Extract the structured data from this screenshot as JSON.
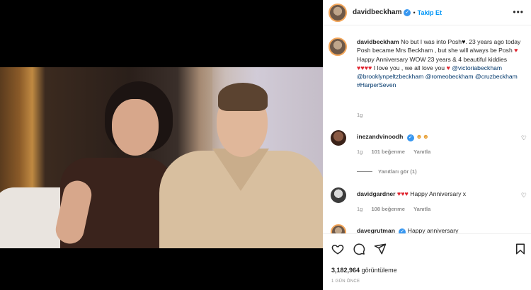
{
  "header": {
    "username": "davidbeckham",
    "separator": "•",
    "follow_label": "Takip Et",
    "more_icon": "more-icon"
  },
  "caption": {
    "username": "davidbeckham",
    "line1": "No but I was into Posh",
    "line1b": ". 23",
    "line2": "years ago today Posh became Mrs Beckham , but",
    "line3a": "she will always be Posh",
    "line3b": "Happy Anniversary",
    "line4": "WOW 23 years & 4 beautiful kiddies",
    "line5a": "I love you , we all love you",
    "mention1": "@victoriabeckham",
    "mention2": "@brooklynpeltzbeckham",
    "mention3": "@romeobeckham",
    "mention4": "@cruzbeckham",
    "tag1": "#HarperSeven",
    "time": "1g"
  },
  "comments": [
    {
      "username": "inezandvinoodh",
      "text": "",
      "time": "1g",
      "likes": "101 beğenme",
      "reply": "Yanıtla"
    },
    {
      "username": "davidgardner",
      "text": "Happy Anniversary x",
      "time": "1g",
      "likes": "108 beğenme",
      "reply": "Yanıtla"
    },
    {
      "username": "davegrutman",
      "text": "Happy anniversary"
    }
  ],
  "replies_label": "Yanıtları gör (1)",
  "stats": {
    "views_count": "3,182,964",
    "views_label": "görüntüleme",
    "posted_ago": "1 GÜN ÖNCE"
  },
  "colors": {
    "accent": "#0095f6",
    "heart": "#e0222d",
    "mention": "#00376b"
  }
}
